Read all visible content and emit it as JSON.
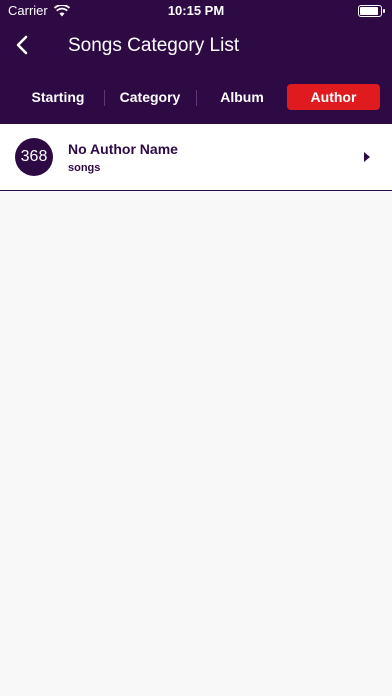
{
  "status_bar": {
    "carrier": "Carrier",
    "time": "10:15 PM"
  },
  "nav": {
    "title": "Songs Category List"
  },
  "tabs": [
    {
      "label": "Starting",
      "active": false
    },
    {
      "label": "Category",
      "active": false
    },
    {
      "label": "Album",
      "active": false
    },
    {
      "label": "Author",
      "active": true
    }
  ],
  "list": [
    {
      "count": "368",
      "name": "No Author Name",
      "subtitle": "songs"
    }
  ],
  "colors": {
    "primary": "#2e0a45",
    "accent": "#e01b20",
    "background": "#f8f8f8"
  },
  "icons": {
    "back": "chevron-left-icon",
    "wifi": "wifi-icon",
    "battery": "battery-icon",
    "row_arrow": "disclosure-triangle-icon"
  }
}
